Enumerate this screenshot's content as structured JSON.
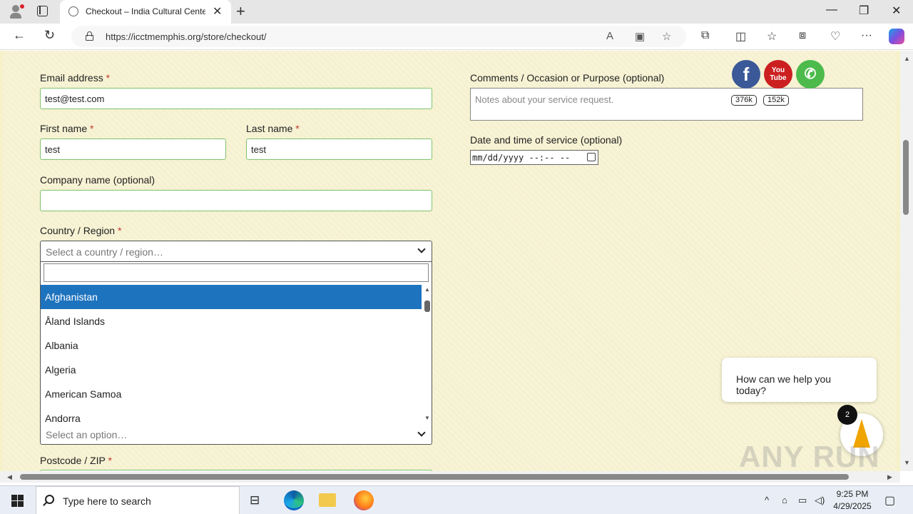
{
  "browser": {
    "tab_title": "Checkout – India Cultural Center",
    "url": "https://icctmemphis.org/store/checkout/"
  },
  "form": {
    "email_label": "Email address",
    "email_value": "test@test.com",
    "first_name_label": "First name",
    "first_name_value": "test",
    "last_name_label": "Last name",
    "last_name_value": "test",
    "company_label": "Company name (optional)",
    "company_value": "",
    "country_label": "Country / Region",
    "country_placeholder": "Select a country / region…",
    "country_options": [
      "Afghanistan",
      "Åland Islands",
      "Albania",
      "Algeria",
      "American Samoa",
      "Andorra"
    ],
    "state_placeholder": "Select an option…",
    "postcode_label": "Postcode / ZIP",
    "required_mark": "*",
    "comments_label": "Comments / Occasion or Purpose (optional)",
    "comments_placeholder": "Notes about your service request.",
    "datetime_label": "Date and time of service (optional)",
    "datetime_value": "mm/dd/yyyy --:-- --"
  },
  "social": {
    "facebook_count": "376k",
    "youtube_count": "152k",
    "youtube_label": "You Tube"
  },
  "chat": {
    "prompt": "How can we help you today?",
    "badge_count": "2"
  },
  "watermark": "ANY RUN",
  "taskbar": {
    "search_placeholder": "Type here to search",
    "time": "9:25 PM",
    "date": "4/29/2025"
  }
}
